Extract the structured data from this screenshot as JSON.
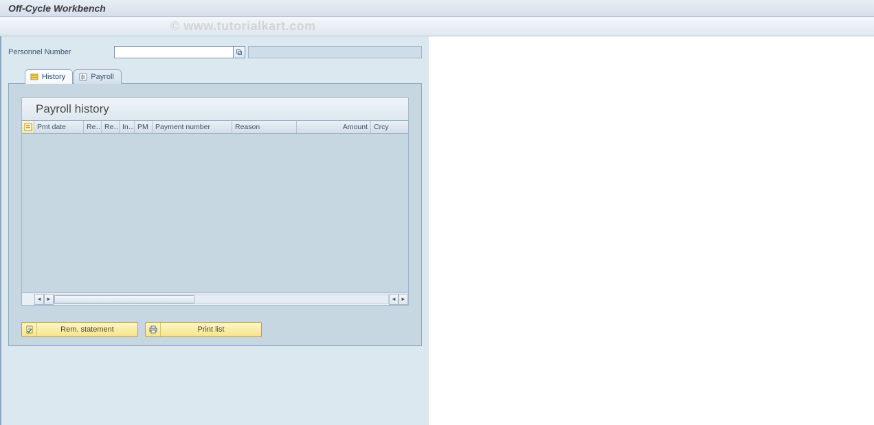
{
  "title": "Off-Cycle Workbench",
  "watermark": "© www.tutorialkart.com",
  "fields": {
    "personnel_number_label": "Personnel Number",
    "personnel_number_value": ""
  },
  "tabs": {
    "history": "History",
    "payroll": "Payroll"
  },
  "section": {
    "title": "Payroll history"
  },
  "columns": {
    "pmt_date": "Pmt date",
    "re1": "Re…",
    "re2": "Re…",
    "in": "In…",
    "pm": "PM",
    "payment_number": "Payment number",
    "reason": "Reason",
    "amount": "Amount",
    "crcy": "Crcy"
  },
  "buttons": {
    "rem_statement": "Rem. statement",
    "print_list": "Print list"
  }
}
